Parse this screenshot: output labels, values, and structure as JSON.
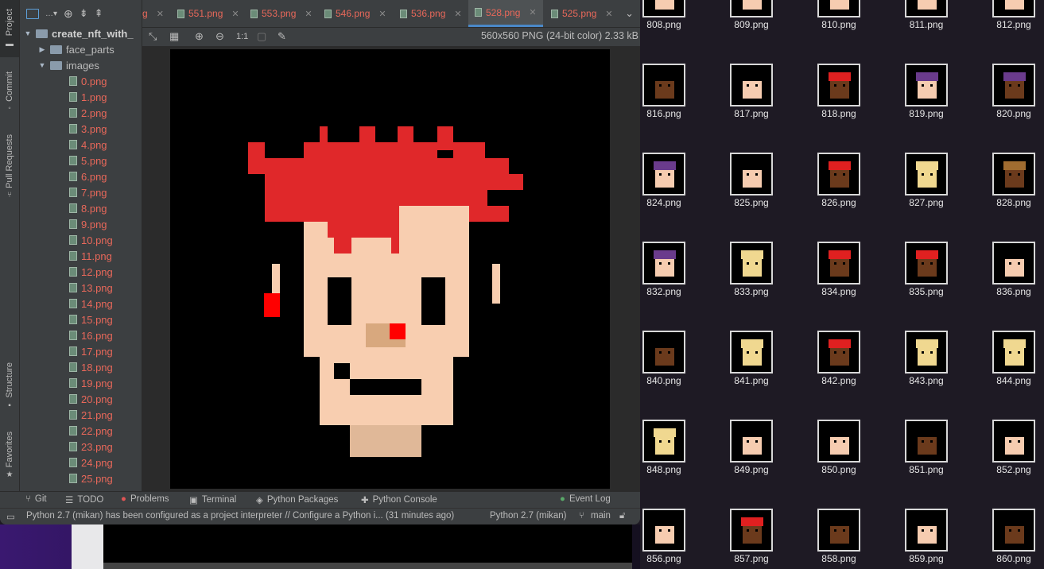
{
  "ide": {
    "tool_window_tabs": [
      "Project",
      "Commit",
      "Pull Requests",
      "Structure",
      "Favorites"
    ],
    "project_root": "create_nft_with_",
    "folders": [
      "face_parts",
      "images"
    ],
    "files": [
      "0.png",
      "1.png",
      "2.png",
      "3.png",
      "4.png",
      "5.png",
      "6.png",
      "7.png",
      "8.png",
      "9.png",
      "10.png",
      "11.png",
      "12.png",
      "13.png",
      "14.png",
      "15.png",
      "16.png",
      "17.png",
      "18.png",
      "19.png",
      "20.png",
      "21.png",
      "22.png",
      "23.png",
      "24.png",
      "25.png"
    ],
    "editor_tabs": [
      {
        "label": "g"
      },
      {
        "label": "551.png"
      },
      {
        "label": "553.png"
      },
      {
        "label": "546.png"
      },
      {
        "label": "536.png"
      },
      {
        "label": "528.png",
        "active": true
      },
      {
        "label": "525.png"
      }
    ],
    "image_info": "560x560 PNG (24-bit color) 2.33 kB",
    "zoom_actual_label": "1:1",
    "bottom_tools": [
      "Git",
      "TODO",
      "Problems",
      "Terminal",
      "Python Packages",
      "Python Console",
      "Event Log"
    ],
    "status_message": "Python 2.7 (mikan) has been configured as a project interpreter // Configure a Python i... (31 minutes ago)",
    "interpreter": "Python 2.7 (mikan)",
    "branch": "main"
  },
  "finder": {
    "files": [
      "808.png",
      "809.png",
      "810.png",
      "811.png",
      "812.png",
      "816.png",
      "817.png",
      "818.png",
      "819.png",
      "820.png",
      "824.png",
      "825.png",
      "826.png",
      "827.png",
      "828.png",
      "832.png",
      "833.png",
      "834.png",
      "835.png",
      "836.png",
      "840.png",
      "841.png",
      "842.png",
      "843.png",
      "844.png",
      "848.png",
      "849.png",
      "850.png",
      "851.png",
      "852.png",
      "856.png",
      "857.png",
      "858.png",
      "859.png",
      "860.png"
    ],
    "thumbs": [
      {
        "skin": "#f6ccb0",
        "hair": "#000000"
      },
      {
        "skin": "#f6ccb0",
        "hair": "#000000"
      },
      {
        "skin": "#f6ccb0",
        "hair": "#000000"
      },
      {
        "skin": "#f6ccb0",
        "hair": "#000000"
      },
      {
        "skin": "#f6ccb0",
        "hair": "#000000"
      },
      {
        "skin": "#6b3a1c",
        "hair": "#000000"
      },
      {
        "skin": "#f6ccb0",
        "hair": "#000000"
      },
      {
        "skin": "#6b3a1c",
        "hair": "#e02020"
      },
      {
        "skin": "#f6ccb0",
        "hair": "#6a3b8c"
      },
      {
        "skin": "#6b3a1c",
        "hair": "#6a3b8c"
      },
      {
        "skin": "#f6ccb0",
        "hair": "#6a3b8c"
      },
      {
        "skin": "#f6ccb0",
        "hair": "#000000"
      },
      {
        "skin": "#6b3a1c",
        "hair": "#e02020"
      },
      {
        "skin": "#f0d890",
        "hair": "#f0d890"
      },
      {
        "skin": "#6b3a1c",
        "hair": "#a06c30"
      },
      {
        "skin": "#f6ccb0",
        "hair": "#6a3b8c"
      },
      {
        "skin": "#f0d890",
        "hair": "#f0d890"
      },
      {
        "skin": "#6b3a1c",
        "hair": "#e02020"
      },
      {
        "skin": "#6b3a1c",
        "hair": "#e02020"
      },
      {
        "skin": "#f6ccb0",
        "hair": "#000000"
      },
      {
        "skin": "#6b3a1c",
        "hair": "#000000"
      },
      {
        "skin": "#f0d890",
        "hair": "#f0d890"
      },
      {
        "skin": "#6b3a1c",
        "hair": "#e02020"
      },
      {
        "skin": "#f0d890",
        "hair": "#f0d890"
      },
      {
        "skin": "#f0d890",
        "hair": "#f0d890"
      },
      {
        "skin": "#f0d890",
        "hair": "#f0d890"
      },
      {
        "skin": "#f6ccb0",
        "hair": "#000000"
      },
      {
        "skin": "#f6ccb0",
        "hair": "#000000"
      },
      {
        "skin": "#6b3a1c",
        "hair": "#000000"
      },
      {
        "skin": "#f6ccb0",
        "hair": "#000000"
      },
      {
        "skin": "#f6ccb0",
        "hair": "#000000"
      },
      {
        "skin": "#6b3a1c",
        "hair": "#e02020"
      },
      {
        "skin": "#6b3a1c",
        "hair": "#000000"
      },
      {
        "skin": "#f6ccb0",
        "hair": "#000000"
      },
      {
        "skin": "#6b3a1c",
        "hair": "#000000"
      }
    ]
  },
  "colors": {
    "hair_red": "#e0282a",
    "skin": "#f8ceb0",
    "nose": "#d8a87e",
    "neck": "#e0b898",
    "accent_red": "#ff0000"
  }
}
